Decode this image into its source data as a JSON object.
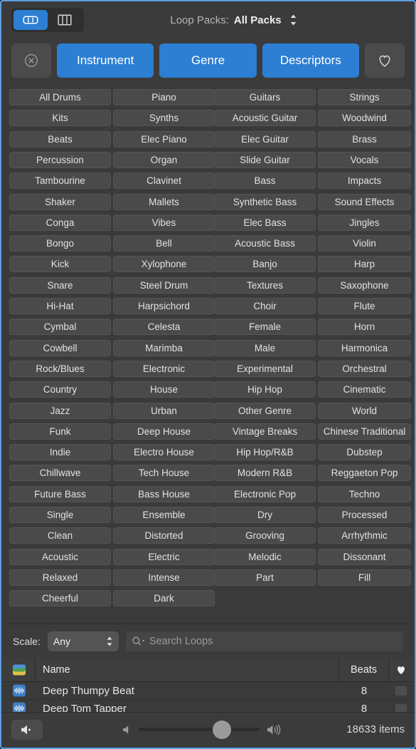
{
  "window": {
    "accent_blue": "#2d7fd3",
    "bg": "#3a3a3a"
  },
  "topbar": {
    "view_list_icon": "list-view-icon",
    "view_column_icon": "column-view-icon",
    "packs_label": "Loop Packs:",
    "packs_value": "All Packs"
  },
  "filterbar": {
    "clear_icon": "clear-circle-icon",
    "buttons": [
      "Instrument",
      "Genre",
      "Descriptors"
    ],
    "favorite_icon": "heart-outline-icon"
  },
  "keywords": {
    "col1": [
      "All Drums",
      "Kits",
      "Beats",
      "Percussion",
      "Tambourine",
      "Shaker",
      "Conga",
      "Bongo",
      "Kick",
      "Snare",
      "Hi-Hat",
      "Cymbal",
      "Cowbell",
      "Rock/Blues",
      "Country",
      "Jazz",
      "Funk",
      "Indie",
      "Chillwave",
      "Future Bass",
      "Single",
      "Clean",
      "Acoustic",
      "Relaxed",
      "Cheerful"
    ],
    "col2": [
      "Piano",
      "Synths",
      "Elec Piano",
      "Organ",
      "Clavinet",
      "Mallets",
      "Vibes",
      "Bell",
      "Xylophone",
      "Steel Drum",
      "Harpsichord",
      "Celesta",
      "Marimba",
      "Electronic",
      "House",
      "Urban",
      "Deep House",
      "Electro House",
      "Tech House",
      "Bass House",
      "Ensemble",
      "Distorted",
      "Electric",
      "Intense",
      "Dark"
    ],
    "col3": [
      "Guitars",
      "Acoustic Guitar",
      "Elec Guitar",
      "Slide Guitar",
      "Bass",
      "Synthetic Bass",
      "Elec Bass",
      "Acoustic Bass",
      "Banjo",
      "Textures",
      "Choir",
      "Female",
      "Male",
      "Experimental",
      "Hip Hop",
      "Other Genre",
      "Vintage Breaks",
      "Hip Hop/R&B",
      "Modern R&B",
      "Electronic Pop",
      "Dry",
      "Grooving",
      "Melodic",
      "Part"
    ],
    "col4": [
      "Strings",
      "Woodwind",
      "Brass",
      "Vocals",
      "Impacts",
      "Sound Effects",
      "Jingles",
      "Violin",
      "Harp",
      "Saxophone",
      "Flute",
      "Horn",
      "Harmonica",
      "Orchestral",
      "Cinematic",
      "World",
      "Chinese Traditional",
      "Dubstep",
      "Reggaeton Pop",
      "Techno",
      "Processed",
      "Arrhythmic",
      "Dissonant",
      "Fill"
    ]
  },
  "scalebar": {
    "scale_label": "Scale:",
    "scale_value": "Any",
    "search_icon": "search-magnifier-icon",
    "search_value": "",
    "search_placeholder": "Search Loops"
  },
  "results": {
    "headers": {
      "icon": "loop-type-icon",
      "name": "Name",
      "beats": "Beats",
      "favorite": "heart-filled-icon"
    },
    "rows": [
      {
        "icon": "waveform-loop-icon",
        "name": "Deep Thumpy Beat",
        "beats": "8"
      },
      {
        "icon": "waveform-loop-icon",
        "name": "Deep Tom Tapper",
        "beats": "8"
      }
    ]
  },
  "bottombar": {
    "mute_icon": "speaker-mute-icon",
    "vol_low_icon": "speaker-low-icon",
    "vol_high_icon": "speaker-high-icon",
    "volume_percent": 62,
    "items_count": "18633 items"
  }
}
